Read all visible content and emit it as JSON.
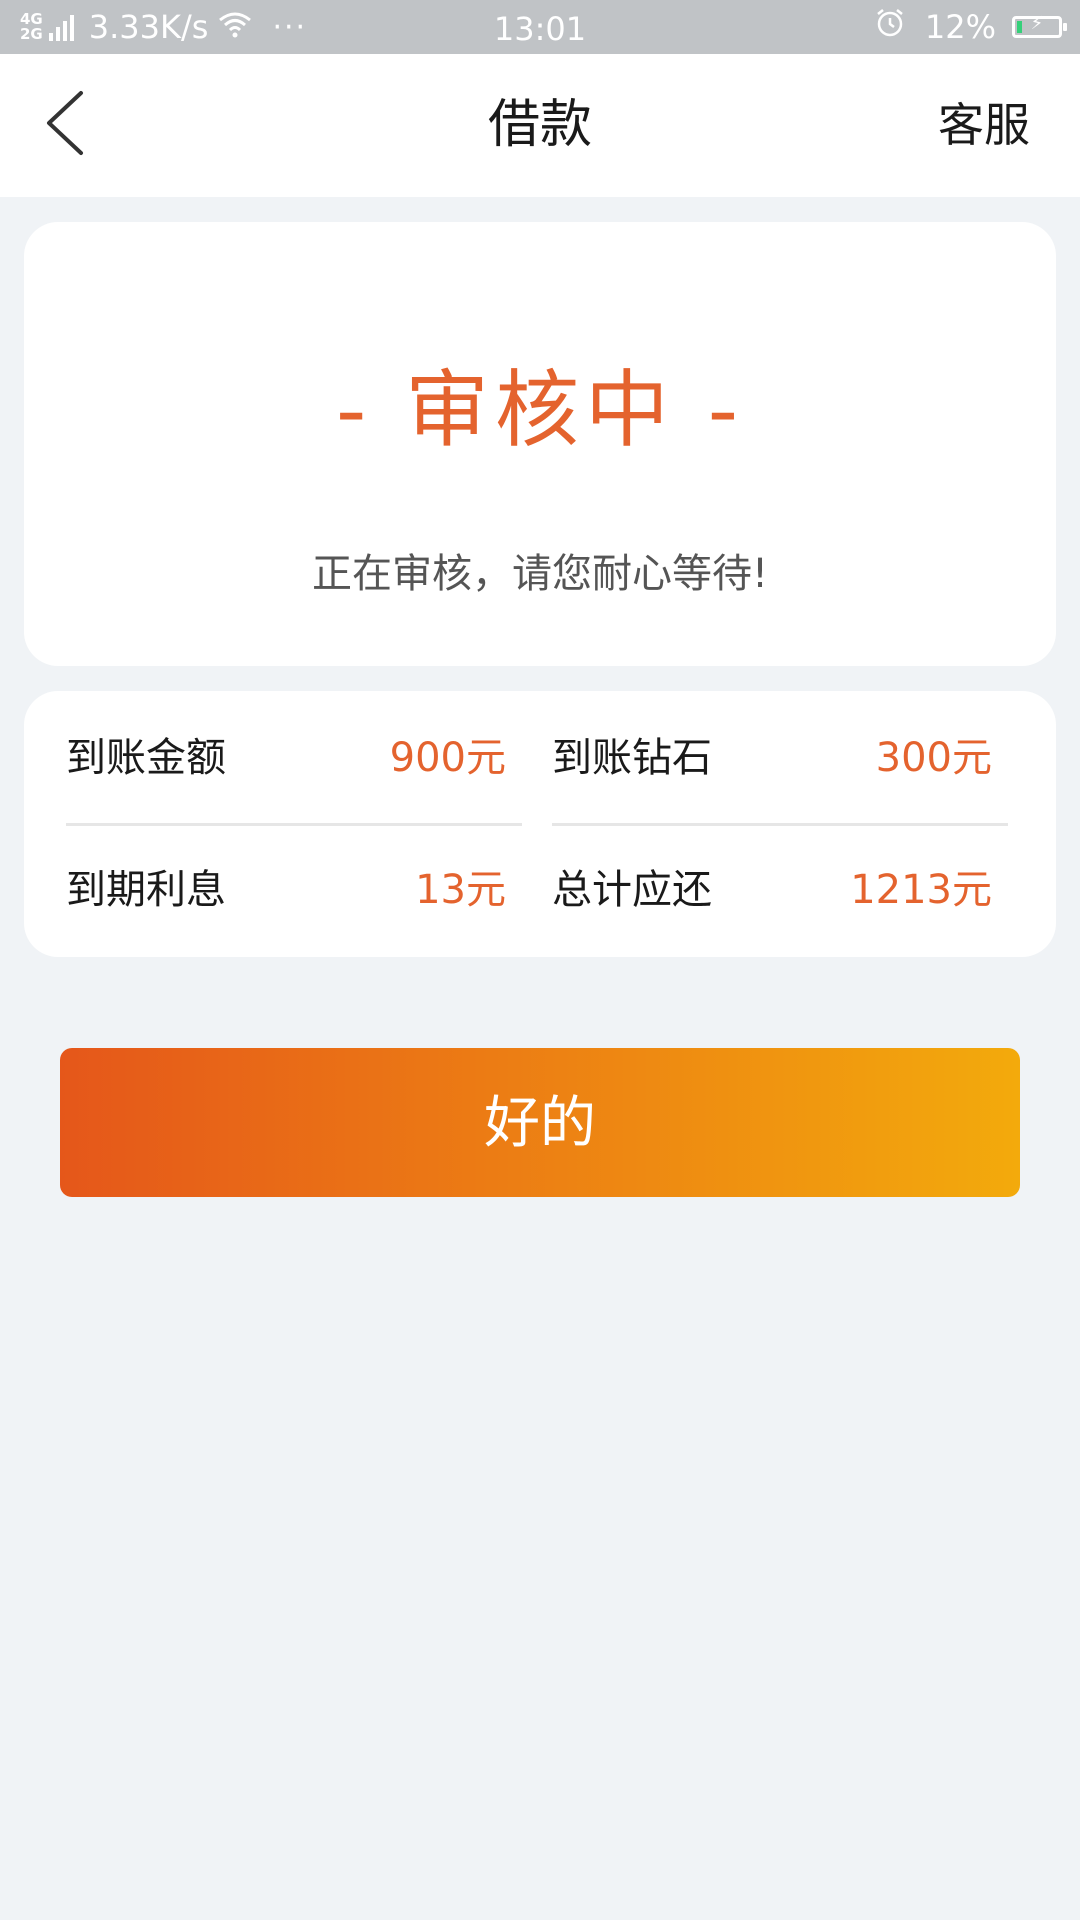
{
  "status_bar": {
    "network_type_top": "4G",
    "network_type_bottom": "2G",
    "net_speed": "3.33K/s",
    "wifi_icon": "wifi-icon",
    "more_icon": "···",
    "time": "13:01",
    "alarm_icon": "alarm-clock-icon",
    "battery_percent": "12%",
    "battery_level": 0.12,
    "battery_color": "#35d07a"
  },
  "nav": {
    "back_icon": "chevron-left-icon",
    "title": "借款",
    "service_label": "客服"
  },
  "status_card": {
    "heading": "- 审核中 -",
    "description": "正在审核，请您耐心等待!",
    "accent_color": "#e4632e"
  },
  "details": {
    "received_amount_label": "到账金额",
    "received_amount_value": "900元",
    "received_diamonds_label": "到账钻石",
    "received_diamonds_value": "300元",
    "interest_label": "到期利息",
    "interest_value": "13元",
    "total_label": "总计应还",
    "total_value": "1213元"
  },
  "confirm_button": {
    "label": "好的",
    "gradient_start": "#e5571a",
    "gradient_end": "#f3aa0c"
  }
}
